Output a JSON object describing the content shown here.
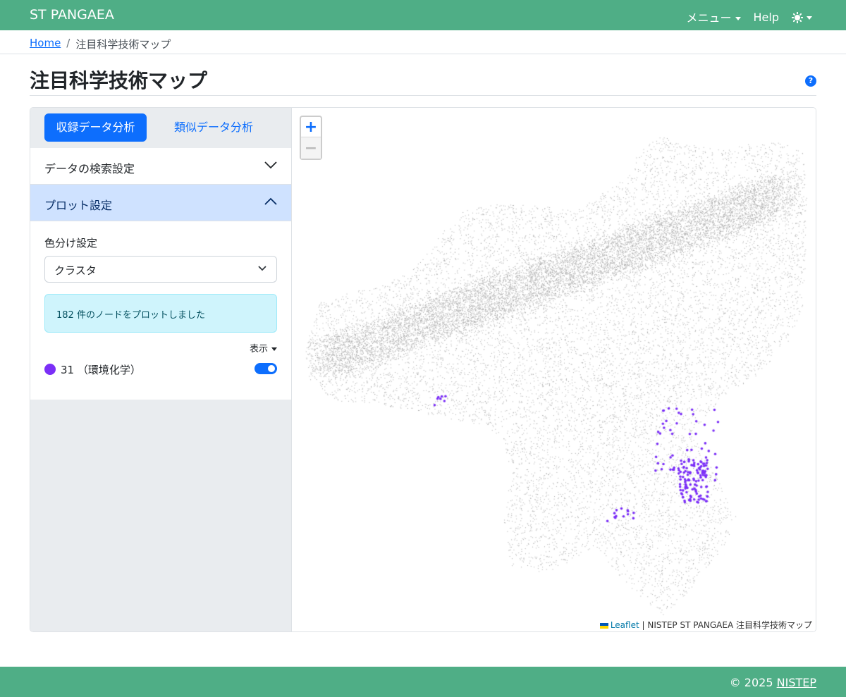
{
  "navbar": {
    "brand": "ST PANGAEA",
    "menu_label": "メニュー",
    "help_label": "Help",
    "theme_icon": "sun-icon"
  },
  "breadcrumb": {
    "home": "Home",
    "separator": "/",
    "current": "注目科学技術マップ"
  },
  "page": {
    "title": "注目科学技術マップ",
    "help_icon": "?"
  },
  "tabs": {
    "active": "収録データ分析",
    "other": "類似データ分析"
  },
  "accordion": {
    "search_settings": "データの検索設定",
    "plot_settings": "プロット設定"
  },
  "plot": {
    "color_label": "色分け設定",
    "color_value": "クラスタ",
    "alert": "182 件のノードをプロットしました",
    "display_label": "表示",
    "legend": [
      {
        "label": "31 （環境化学）",
        "color": "#7b2ff7",
        "enabled": true
      }
    ]
  },
  "map": {
    "zoom_in": "+",
    "zoom_out": "−",
    "attribution_link": "Leaflet",
    "attribution_text": "| NISTEP ST PANGAEA 注目科学技術マップ",
    "highlight_node_count": 182,
    "base_color": "#a9a9a9",
    "highlight_color": "#7b2ff7"
  },
  "footer": {
    "copyright": "© 2025",
    "link": "NISTEP"
  },
  "colors": {
    "navbar": "#4fae86",
    "primary": "#0d6efd",
    "accordion_active": "#cfe2ff",
    "alert_bg": "#cff4fc"
  }
}
